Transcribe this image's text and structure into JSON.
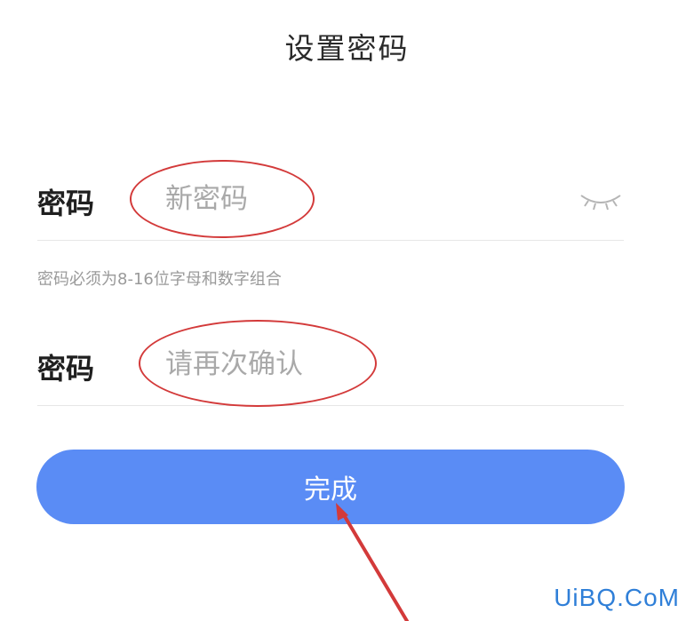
{
  "page": {
    "title": "设置密码"
  },
  "form": {
    "password": {
      "label": "密码",
      "placeholder": "新密码",
      "visibility_icon": "eye-closed-icon"
    },
    "hint": "密码必须为8-16位字母和数字组合",
    "confirm": {
      "label": "密码",
      "placeholder": "请再次确认"
    },
    "submit_label": "完成"
  },
  "annotations": {
    "color": "#d33a3a"
  },
  "colors": {
    "accent": "#5a8cf5",
    "watermark": "#2f7fd8"
  },
  "watermark": "UiBQ.CoM"
}
